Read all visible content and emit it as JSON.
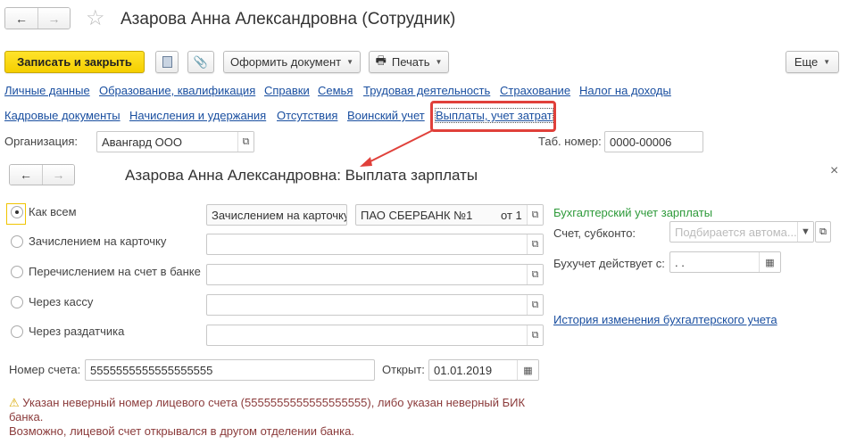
{
  "window": {
    "title": "Азарова Анна Александровна (Сотрудник)"
  },
  "toolbar": {
    "save_close": "Записать и закрыть",
    "create_doc": "Оформить документ",
    "print": "Печать",
    "more": "Еще"
  },
  "links_row1": [
    "Личные данные",
    "Образование, квалификация",
    "Справки",
    "Семья",
    "Трудовая деятельность",
    "Страхование",
    "Налог на доходы"
  ],
  "links_row2": [
    "Кадровые документы",
    "Начисления и удержания",
    "Отсутствия",
    "Воинский учет",
    "Выплаты, учет затрат"
  ],
  "org": {
    "label": "Организация:",
    "value": "Авангард ООО",
    "tab_label": "Таб. номер:",
    "tab_value": "0000-00006"
  },
  "subform": {
    "title": "Азарова Анна Александровна: Выплата зарплаты",
    "close": "×",
    "options": [
      "Как всем",
      "Зачислением на карточку",
      "Перечислением на счет в банке",
      "Через кассу",
      "Через раздатчика"
    ],
    "selected_option": "Как всем",
    "row1_method": "Зачислением на карточку",
    "row1_bank": "ПАО СБЕРБАНК №1",
    "row1_from": "от 1",
    "accounting_title": "Бухгалтерский учет зарплаты",
    "account_label": "Счет, субконто:",
    "account_placeholder": "Подбирается автома...",
    "effective_label": "Бухучет действует с:",
    "effective_value": " .  .",
    "history_link": "История изменения бухгалтерского учета",
    "account_no_label": "Номер счета:",
    "account_no_value": "5555555555555555555",
    "opened_label": "Открыт:",
    "opened_value": "01.01.2019",
    "warning_line1": "Указан неверный номер лицевого счета (5555555555555555555), либо указан неверный БИК",
    "warning_line2": "банка.",
    "warning_line3": "Возможно, лицевой счет открывался в другом отделении банка."
  },
  "colors": {
    "accent_yellow": "#f5cf00",
    "link": "#1a4fa0",
    "green": "#2e9a3a",
    "warning": "#8b3b3b",
    "highlight": "#e0403a"
  }
}
